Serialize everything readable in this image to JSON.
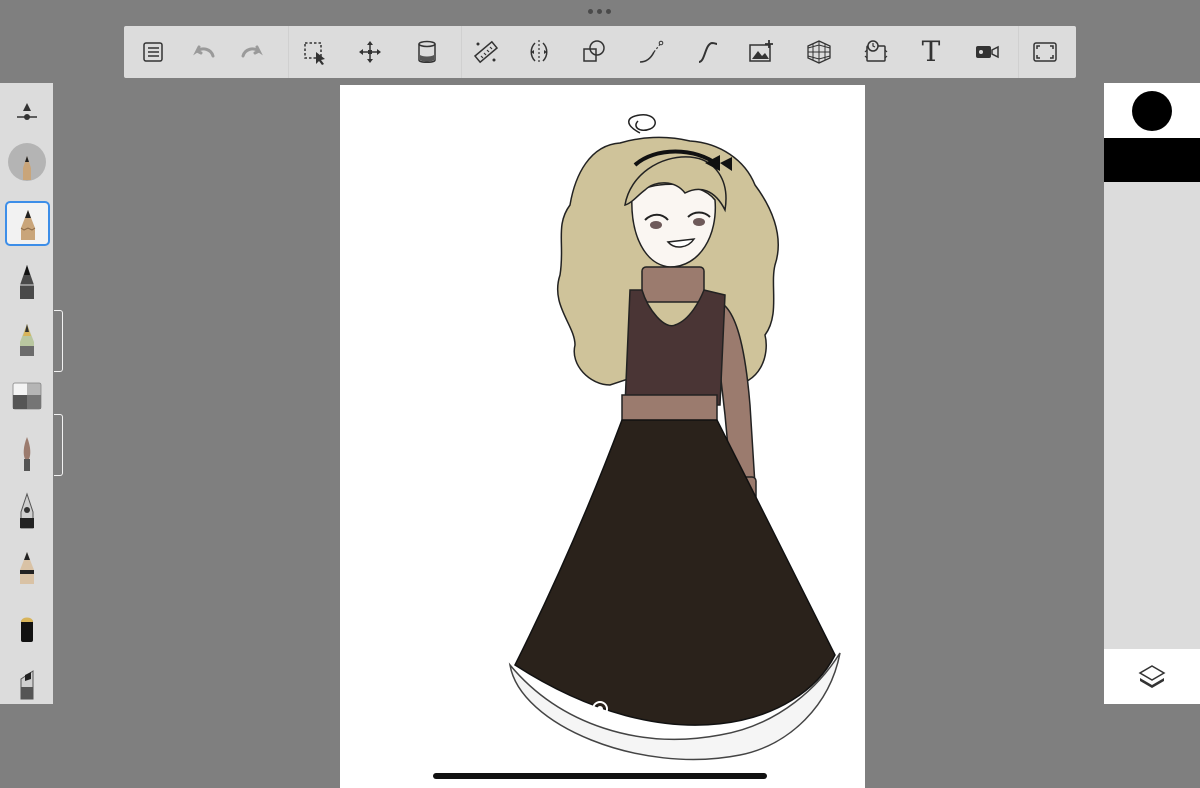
{
  "toolbar": {
    "icons": [
      "list-icon",
      "undo-icon",
      "redo-icon",
      "selection-icon",
      "transform-icon",
      "fill-icon",
      "ruler-icon",
      "symmetry-icon",
      "shape-icon",
      "stroke-icon",
      "curve-icon",
      "image-import-icon",
      "perspective-icon",
      "time-lapse-icon",
      "text-icon",
      "video-icon",
      "fullscreen-icon"
    ],
    "text_tool_glyph": "T"
  },
  "left_panel": {
    "brushes": [
      "size-slider-icon",
      "brush-preview-icon",
      "pencil-icon",
      "dark-pencil-icon",
      "airbrush-icon",
      "eraser-icon",
      "paintbrush-icon",
      "fountain-pen-icon",
      "hard-pencil-icon",
      "marker-icon",
      "chisel-marker-icon"
    ],
    "selected_brush": "pencil"
  },
  "right_panel": {
    "current_color": "#000000",
    "layer_color": "#000000"
  },
  "canvas": {
    "background": "#ffffff",
    "artwork": "character-drawing"
  },
  "colors": {
    "workspace": "#7f7f7f",
    "toolbar": "#dcdcdc",
    "selection_accent": "#3d8ee8",
    "hair": "#cfc39a",
    "sweater": "#9b7b6e",
    "vest": "#4a3535",
    "skirt": "#2a221b"
  }
}
